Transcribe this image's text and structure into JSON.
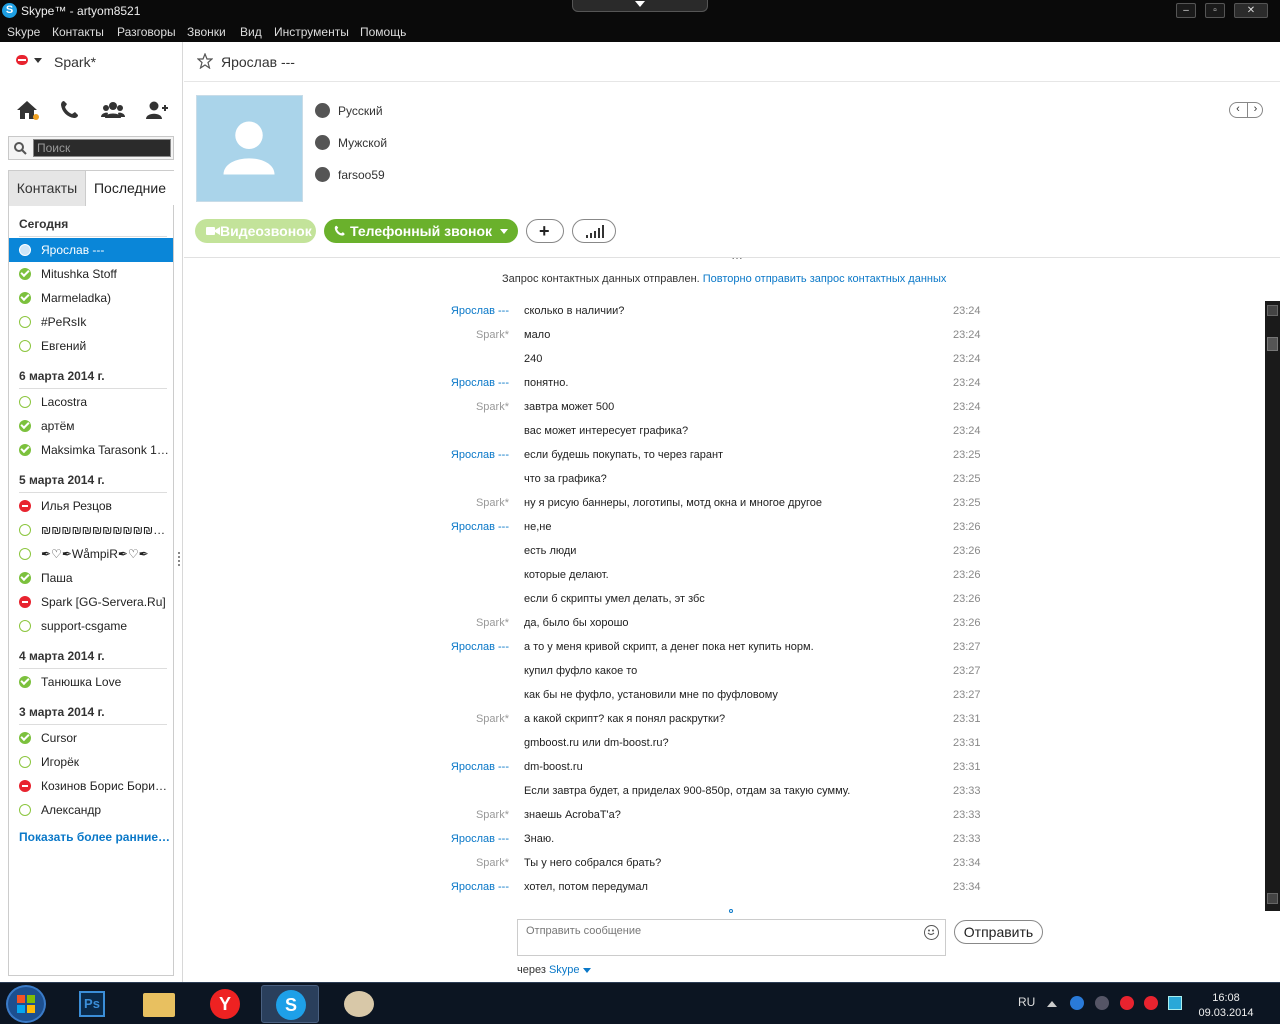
{
  "window": {
    "title": "Skype™ - artyom8521",
    "app_icon_letter": "S",
    "buttons": {
      "minimize": "–",
      "maximize": "▫",
      "close": "✕"
    }
  },
  "menu": [
    "Skype",
    "Контакты",
    "Разговоры",
    "Звонки",
    "Вид",
    "Инструменты",
    "Помощь"
  ],
  "sidebar": {
    "profile_name": "Spark*",
    "nav_icons": [
      "home-icon",
      "phone-icon",
      "group-icon",
      "add-contact-icon"
    ],
    "search_placeholder": "Поиск",
    "tabs": [
      "Контакты",
      "Последние"
    ],
    "groups": [
      {
        "label": "Сегодня",
        "items": [
          {
            "name": "Ярослав ---",
            "status": "skype",
            "selected": true
          },
          {
            "name": "Mitushka Stoff",
            "status": "online"
          },
          {
            "name": "Marmeladka)",
            "status": "online"
          },
          {
            "name": "#PeRsIk",
            "status": "offline"
          },
          {
            "name": "Евгений",
            "status": "offline"
          }
        ]
      },
      {
        "label": "6 марта 2014 г.",
        "items": [
          {
            "name": "Lacostra",
            "status": "offline"
          },
          {
            "name": "артём",
            "status": "online"
          },
          {
            "name": "Maksimka Tarasonk 1337…",
            "status": "online"
          }
        ]
      },
      {
        "label": "5 марта 2014 г.",
        "items": [
          {
            "name": "Илья Резцов",
            "status": "busy"
          },
          {
            "name": "₪₪₪₪₪₪₪₪₪₪₪₪₪₪₪…",
            "status": "offline"
          },
          {
            "name": "✒♡✒WåmpiR✒♡✒",
            "status": "offline"
          },
          {
            "name": "Паша",
            "status": "online"
          },
          {
            "name": "Spark [GG-Servera.Ru]",
            "status": "busy"
          },
          {
            "name": "support-csgame",
            "status": "offline"
          }
        ]
      },
      {
        "label": "4 марта 2014 г.",
        "items": [
          {
            "name": "Танюшка Love",
            "status": "online"
          }
        ]
      },
      {
        "label": "3 марта 2014 г.",
        "items": [
          {
            "name": "Cursor",
            "status": "online"
          },
          {
            "name": "Игорёк",
            "status": "offline"
          },
          {
            "name": "Козинов Борис Борисов…",
            "status": "busy"
          },
          {
            "name": "Александр",
            "status": "offline"
          }
        ]
      }
    ],
    "show_more": "Показать более ранние…"
  },
  "chat": {
    "title": "Ярослав ---",
    "profile": {
      "language": "Русский",
      "gender": "Мужской",
      "skype_name": "farsoo59"
    },
    "buttons": {
      "video": "Видеозвонок",
      "phone": "Телефонный звонок",
      "add": "+"
    },
    "notice_text": "Запрос контактных данных отправлен.",
    "notice_link": "Повторно отправить запрос контактных данных",
    "messages": [
      {
        "sender": "Ярослав ---",
        "who": "y",
        "text": "сколько в наличии?",
        "time": "23:24"
      },
      {
        "sender": "Spark*",
        "who": "s",
        "text": "мало",
        "time": "23:24"
      },
      {
        "sender": "",
        "who": "s",
        "text": "240",
        "time": "23:24"
      },
      {
        "sender": "Ярослав ---",
        "who": "y",
        "text": "понятно.",
        "time": "23:24"
      },
      {
        "sender": "Spark*",
        "who": "s",
        "text": "завтра может 500",
        "time": "23:24"
      },
      {
        "sender": "",
        "who": "s",
        "text": "вас может интересует графика?",
        "time": "23:24"
      },
      {
        "sender": "Ярослав ---",
        "who": "y",
        "text": "если будешь покупать, то через гарант",
        "time": "23:25"
      },
      {
        "sender": "",
        "who": "y",
        "text": "что за графика?",
        "time": "23:25"
      },
      {
        "sender": "Spark*",
        "who": "s",
        "text": "ну я рисую баннеры, логотипы, мотд окна и многое другое",
        "time": "23:25"
      },
      {
        "sender": "Ярослав ---",
        "who": "y",
        "text": "не,не",
        "time": "23:26"
      },
      {
        "sender": "",
        "who": "y",
        "text": "есть люди",
        "time": "23:26"
      },
      {
        "sender": "",
        "who": "y",
        "text": "которые делают.",
        "time": "23:26"
      },
      {
        "sender": "",
        "who": "y",
        "text": "если б скрипты умел делать, эт збс",
        "time": "23:26"
      },
      {
        "sender": "Spark*",
        "who": "s",
        "text": "да, было бы хорошо",
        "time": "23:26"
      },
      {
        "sender": "Ярослав ---",
        "who": "y",
        "text": "а то у меня кривой скрипт, а денег пока нет купить норм.",
        "time": "23:27"
      },
      {
        "sender": "",
        "who": "y",
        "text": "купил фуфло какое то",
        "time": "23:27"
      },
      {
        "sender": "",
        "who": "y",
        "text": "как бы не фуфло, установили мне по фуфловому",
        "time": "23:27"
      },
      {
        "sender": "Spark*",
        "who": "s",
        "text": "а какой скрипт? как я понял раскрутки?",
        "time": "23:31"
      },
      {
        "sender": "",
        "who": "s",
        "text": "gmboost.ru или dm-boost.ru?",
        "time": "23:31"
      },
      {
        "sender": "Ярослав ---",
        "who": "y",
        "text": "dm-boost.ru",
        "time": "23:31"
      },
      {
        "sender": "",
        "who": "y",
        "text": "Если завтра будет, а приделах 900-850р, отдам за такую сумму.",
        "time": "23:33"
      },
      {
        "sender": "Spark*",
        "who": "s",
        "text": "знаешь AcrobaT'a?",
        "time": "23:33"
      },
      {
        "sender": "Ярослав ---",
        "who": "y",
        "text": "Знаю.",
        "time": "23:33"
      },
      {
        "sender": "Spark*",
        "who": "s",
        "text": "Ты у него собрался брать?",
        "time": "23:34"
      },
      {
        "sender": "Ярослав ---",
        "who": "y",
        "text": "хотел, потом передумал",
        "time": "23:34"
      }
    ],
    "input_placeholder": "Отправить сообщение",
    "send_label": "Отправить",
    "via_label": "через",
    "via_link": "Skype"
  },
  "taskbar": {
    "apps": [
      "start-button",
      "photoshop-icon",
      "explorer-icon",
      "yandex-browser-icon",
      "skype-icon",
      "paint-icon"
    ],
    "language": "RU",
    "clock_time": "16:08",
    "clock_date": "09.03.2014"
  }
}
